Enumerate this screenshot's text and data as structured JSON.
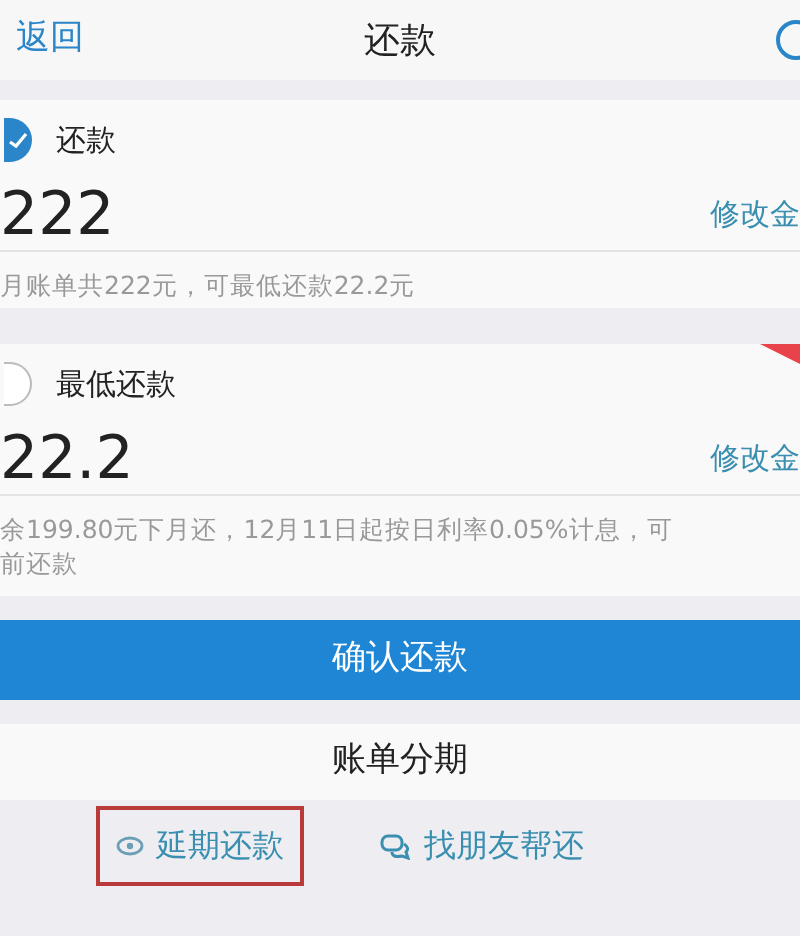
{
  "nav": {
    "back": "返回",
    "title": "还款"
  },
  "options": [
    {
      "label": "还款",
      "selected": true,
      "amount": "222",
      "edit": "修改金",
      "note_lines": [
        "月账单共222元，可最低还款22.2元"
      ],
      "ribbon": false
    },
    {
      "label": "最低还款",
      "selected": false,
      "amount": "22.2",
      "edit": "修改金",
      "note_lines": [
        "余199.80元下月还，12月11日起按日利率0.05%计息，可",
        "前还款"
      ],
      "ribbon": true
    }
  ],
  "confirm_button": "确认还款",
  "installment": "账单分期",
  "links": [
    {
      "kind": "defer",
      "label": "延期还款",
      "highlighted": true
    },
    {
      "kind": "friend",
      "label": "找朋友帮还",
      "highlighted": false
    }
  ]
}
